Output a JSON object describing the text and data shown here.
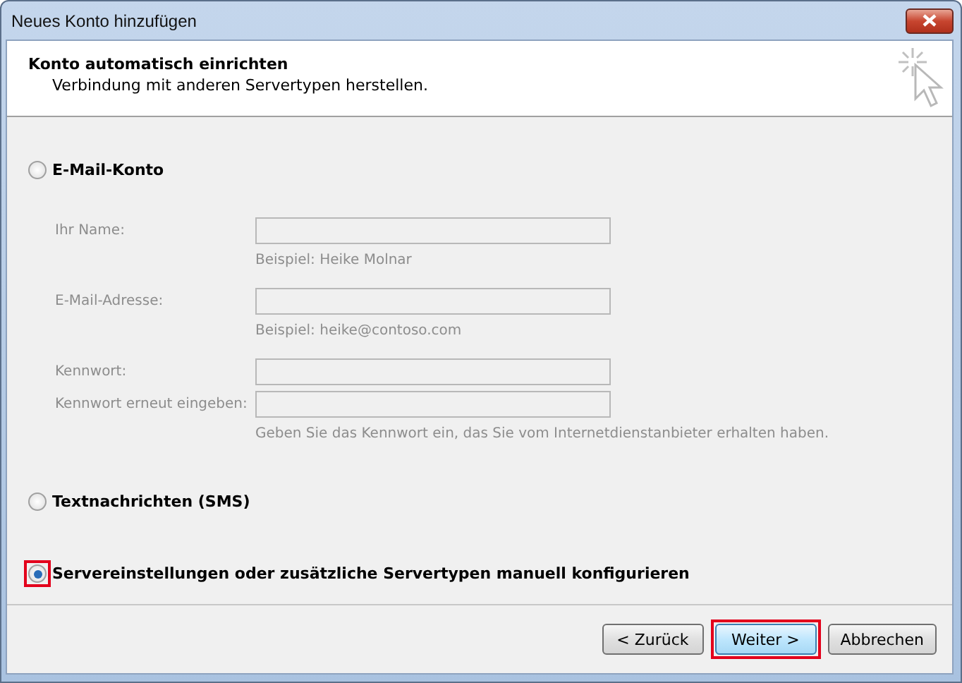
{
  "window": {
    "title": "Neues Konto hinzufügen"
  },
  "header": {
    "title": "Konto automatisch einrichten",
    "subtitle": "Verbindung mit anderen Servertypen herstellen."
  },
  "options": [
    {
      "label": "E-Mail-Konto",
      "selected": false,
      "highlighted": false
    },
    {
      "label": "Textnachrichten (SMS)",
      "selected": false,
      "highlighted": false
    },
    {
      "label": "Servereinstellungen oder zusätzliche Servertypen manuell konfigurieren",
      "selected": true,
      "highlighted": true
    }
  ],
  "fields": [
    {
      "label": "Ihr Name:",
      "hint": "Beispiel: Heike Molnar",
      "disabled": true
    },
    {
      "label": "E-Mail-Adresse:",
      "hint": "Beispiel: heike@contoso.com",
      "disabled": true
    },
    {
      "label": "Kennwort:",
      "disabled": true
    },
    {
      "label": "Kennwort erneut eingeben:",
      "hint": "Geben Sie das Kennwort ein, das Sie vom Internetdienstanbieter erhalten haben.",
      "disabled": true
    }
  ],
  "buttons": [
    {
      "label": "< Zurück",
      "highlighted": false,
      "default": false
    },
    {
      "label": "Weiter >",
      "highlighted": true,
      "default": true
    },
    {
      "label": "Abbrechen",
      "highlighted": false,
      "default": false
    }
  ]
}
